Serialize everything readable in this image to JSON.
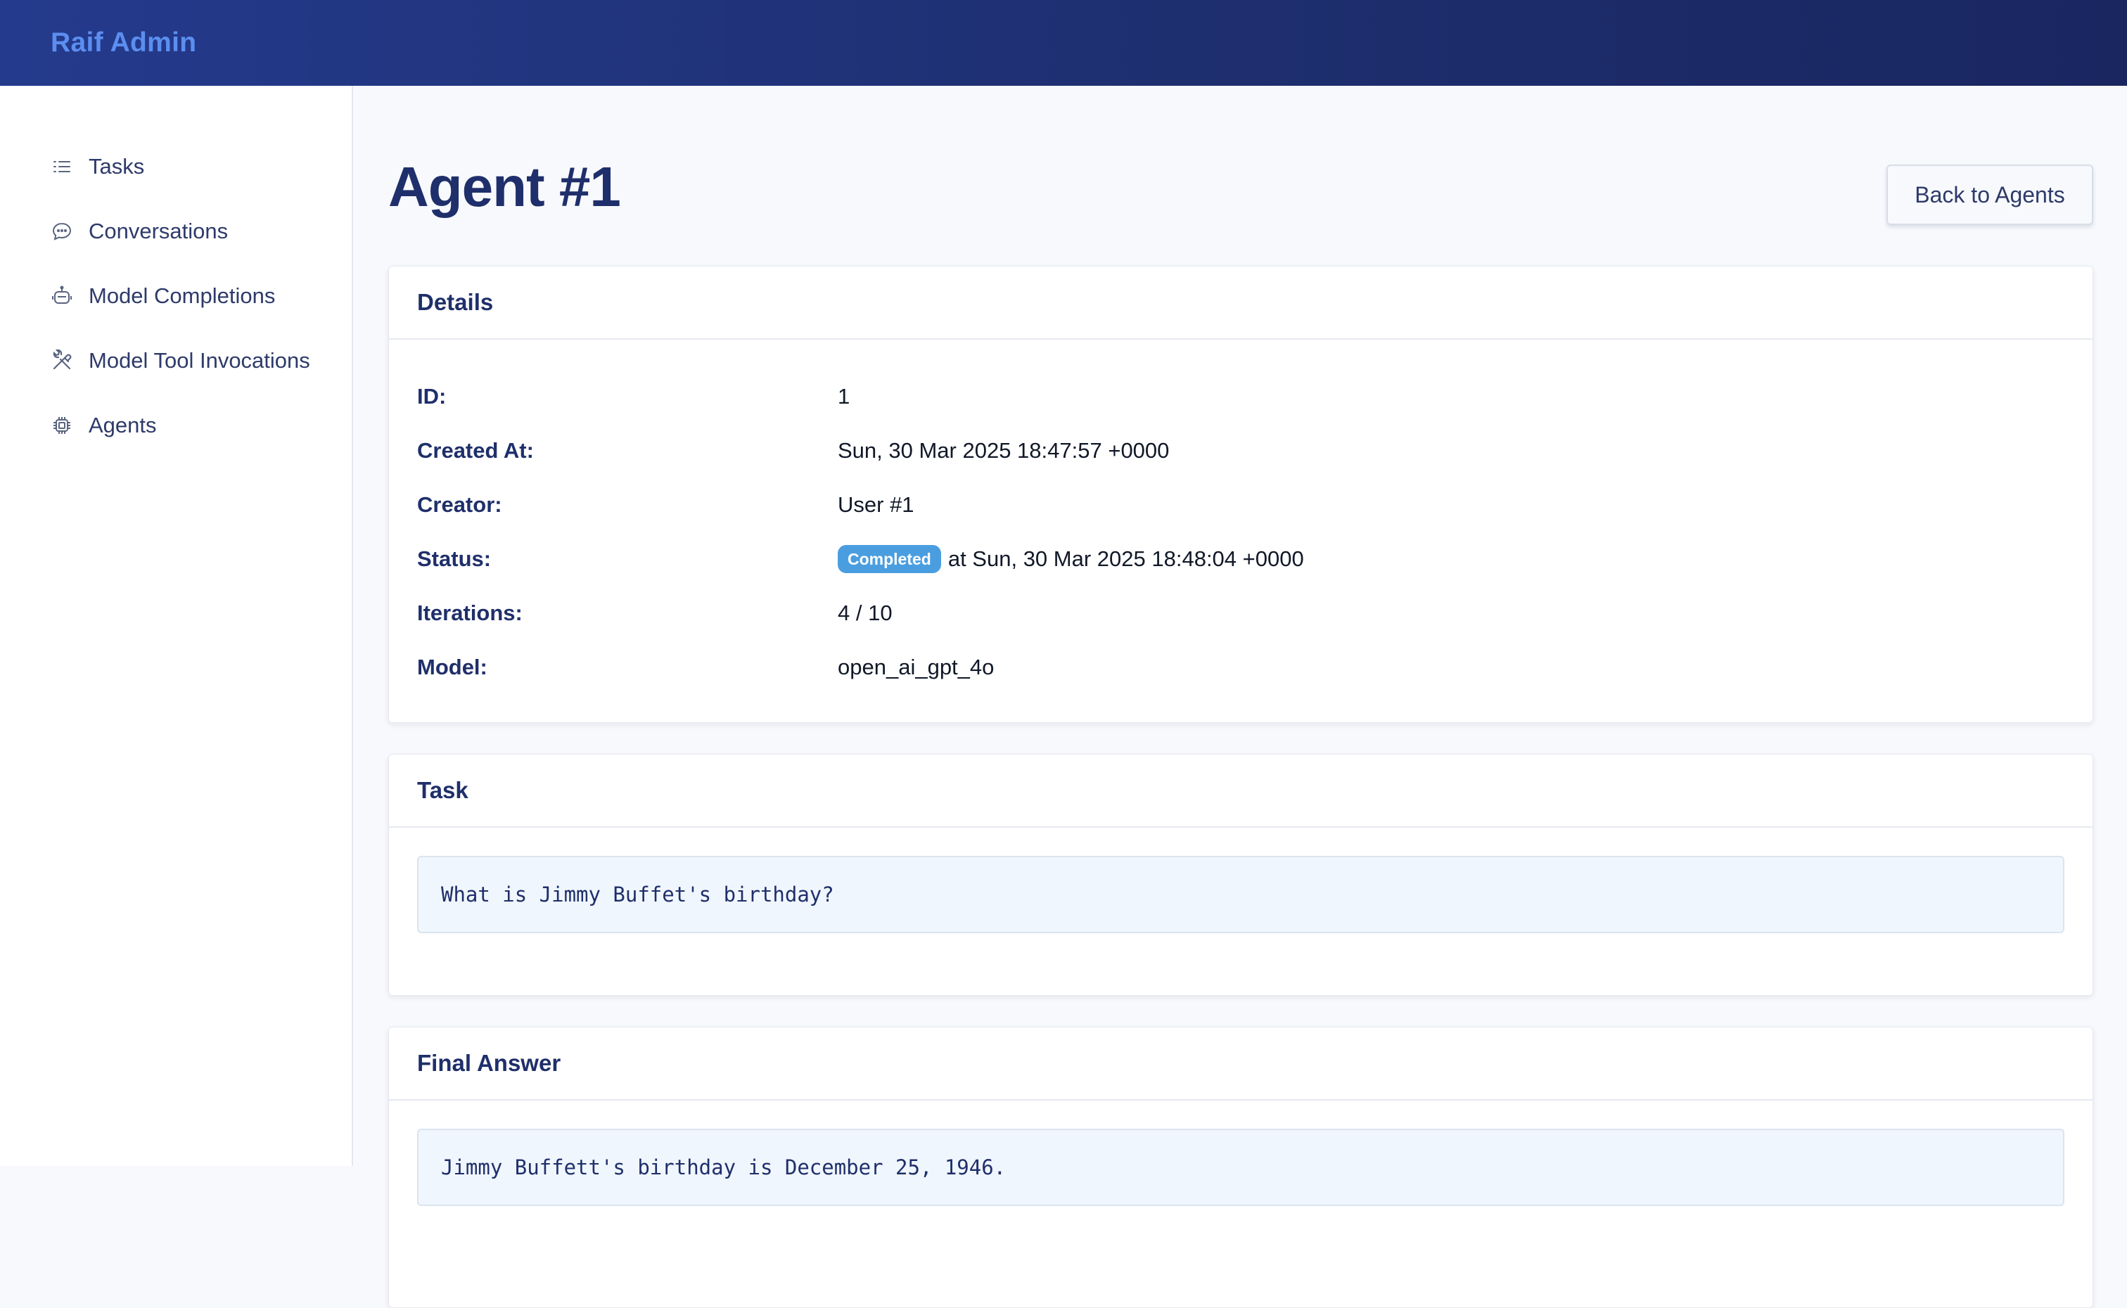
{
  "app": {
    "brand": "Raif Admin"
  },
  "sidebar": {
    "items": [
      {
        "label": "Tasks",
        "icon": "list-icon"
      },
      {
        "label": "Conversations",
        "icon": "chat-bubble-icon"
      },
      {
        "label": "Model Completions",
        "icon": "robot-icon"
      },
      {
        "label": "Model Tool Invocations",
        "icon": "tools-icon"
      },
      {
        "label": "Agents",
        "icon": "chip-icon"
      }
    ]
  },
  "page": {
    "title": "Agent #1",
    "back_label": "Back to Agents"
  },
  "details": {
    "header": "Details",
    "id_label": "ID:",
    "id_value": "1",
    "created_label": "Created At:",
    "created_value": "Sun, 30 Mar 2025 18:47:57 +0000",
    "creator_label": "Creator:",
    "creator_value": "User #1",
    "status_label": "Status:",
    "status_badge": "Completed",
    "status_badge_color": "#4a9ee0",
    "status_suffix": "at Sun, 30 Mar 2025 18:48:04 +0000",
    "iterations_label": "Iterations:",
    "iterations_value": "4 / 10",
    "model_label": "Model:",
    "model_value": "open_ai_gpt_4o"
  },
  "task": {
    "header": "Task",
    "text": "What is Jimmy Buffet's birthday?"
  },
  "final_answer": {
    "header": "Final Answer",
    "text": "Jimmy Buffett's birthday is December 25, 1946."
  },
  "colors": {
    "topbar": "#243a8c",
    "brand": "#5b8ef0",
    "heading": "#1f2f6b"
  }
}
